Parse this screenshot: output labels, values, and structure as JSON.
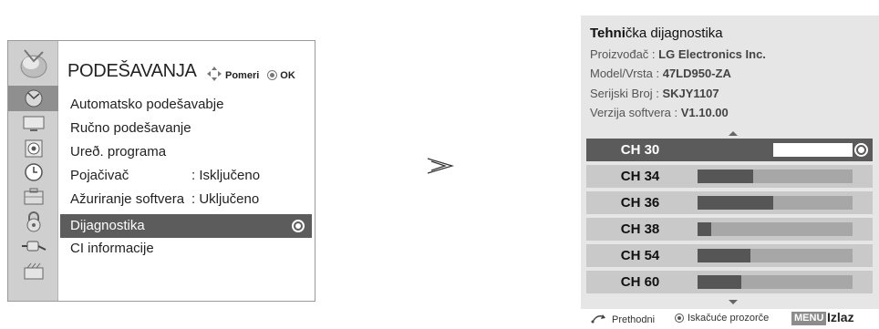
{
  "menu": {
    "title": "PODEŠAVANJA",
    "nav_move": "Pomeri",
    "nav_ok": "OK",
    "items": [
      {
        "label": "Automatsko podešavabje",
        "value": ""
      },
      {
        "label": "Ručno podešavanje",
        "value": ""
      },
      {
        "label": "Ureð. programa",
        "value": ""
      },
      {
        "label": "Pojačivač",
        "value": ": Isključeno"
      },
      {
        "label": "Ažuriranje softvera",
        "value": ": Uključeno"
      },
      {
        "label": "Dijagnostika",
        "value": "",
        "selected": true
      },
      {
        "label": "CI informacije",
        "value": ""
      }
    ],
    "side_icons": [
      "satellite-dish-icon",
      "tv-screen-icon",
      "speaker-icon",
      "clock-icon",
      "options-icon",
      "lock-icon",
      "input-plug-icon",
      "usb-media-icon"
    ]
  },
  "diag": {
    "title_bold": "Tehni",
    "title_rest": "čka dijagnostika",
    "manufacturer_label": "Proizvođač : ",
    "manufacturer_value": "LG Electronics Inc.",
    "model_label": "Model/Vrsta : ",
    "model_value": "47LD950-ZA",
    "serial_label": "Serijski Broj : ",
    "serial_value": "SKJY1107",
    "software_label": "Verzija softvera : ",
    "software_value": "V1.10.00",
    "channels": [
      {
        "name": "CH 30",
        "signal": 0.49,
        "active": true
      },
      {
        "name": "CH 34",
        "signal": 0.36
      },
      {
        "name": "CH 36",
        "signal": 0.49
      },
      {
        "name": "CH 38",
        "signal": 0.09
      },
      {
        "name": "CH 54",
        "signal": 0.34
      },
      {
        "name": "CH 60",
        "signal": 0.28
      }
    ]
  },
  "footer": {
    "previous": "Prethodni",
    "popup": "Iskačuće prozorče",
    "menu_key": "MENU",
    "exit": "Izlaz"
  },
  "colors": {
    "selected_row": "#5c5c5c",
    "channel_row": "#c9c9c9",
    "panel_bg": "#e6e6e6"
  }
}
